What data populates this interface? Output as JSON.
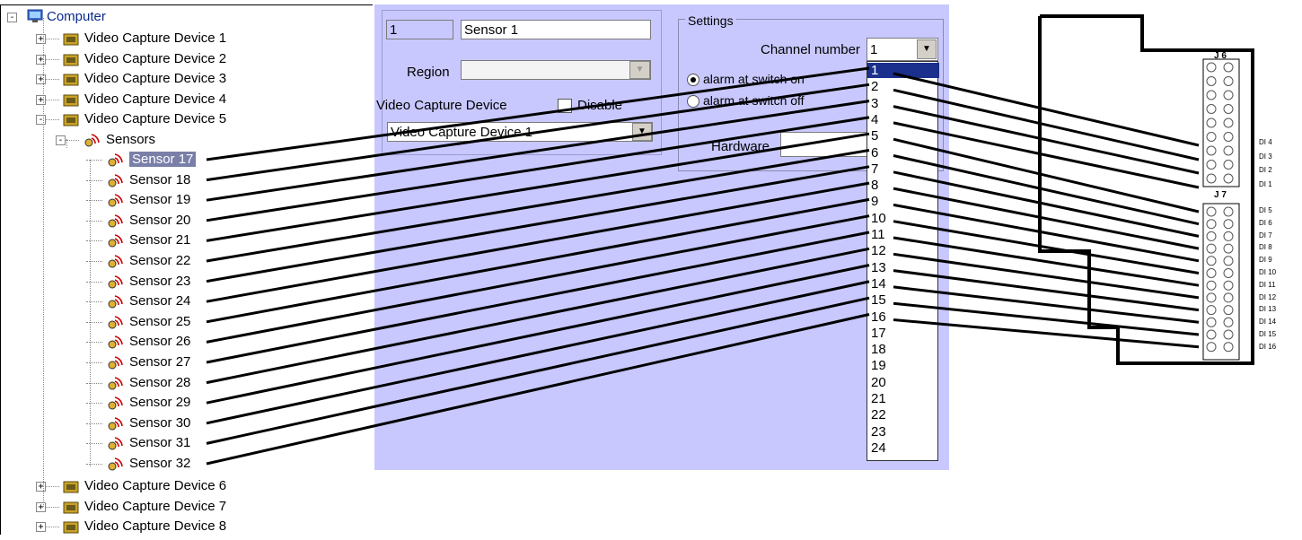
{
  "tree": {
    "root_label": "Computer",
    "devices_before": [
      "Video Capture Device 1",
      "Video Capture Device 2",
      "Video Capture Device 3",
      "Video Capture Device 4",
      "Video Capture Device 5"
    ],
    "sensors_node": "Sensors",
    "sensors": [
      "Sensor 17",
      "Sensor 18",
      "Sensor 19",
      "Sensor 20",
      "Sensor 21",
      "Sensor 22",
      "Sensor 23",
      "Sensor 24",
      "Sensor 25",
      "Sensor 26",
      "Sensor 27",
      "Sensor 28",
      "Sensor 29",
      "Sensor 30",
      "Sensor 31",
      "Sensor 32"
    ],
    "selected_sensor": "Sensor 17",
    "devices_after": [
      "Video Capture Device 6",
      "Video Capture Device 7",
      "Video Capture Device 8"
    ]
  },
  "form": {
    "id_value": "1",
    "name_value": "Sensor 1",
    "region_label": "Region",
    "region_value": "",
    "device_label": "Video Capture Device",
    "disable_label": "Disable",
    "device_value": "Video Capture Device 1"
  },
  "settings": {
    "title": "Settings",
    "channel_label": "Channel number",
    "channel_value": "1",
    "alarm_on_label": "alarm at switch on",
    "alarm_off_label": "alarm at switch off",
    "hardware_label": "Hardware",
    "channel_options": [
      "1",
      "2",
      "3",
      "4",
      "5",
      "6",
      "7",
      "8",
      "9",
      "10",
      "11",
      "12",
      "13",
      "14",
      "15",
      "16",
      "17",
      "18",
      "19",
      "20",
      "21",
      "22",
      "23",
      "24"
    ]
  },
  "pinout": {
    "j6_label": "J 6",
    "j7_label": "J 7",
    "j6_pins": [
      "DI 4",
      "DI 3",
      "DI 2",
      "DI 1"
    ],
    "j7_pins": [
      "DI 5",
      "DI 6",
      "DI 7",
      "DI 8",
      "DI 9",
      "DI 10",
      "DI 11",
      "DI 12",
      "DI 13",
      "DI 14",
      "DI 15",
      "DI 16"
    ]
  },
  "colors": {
    "dialog_bg": "#c8c8ff",
    "selected_bg": "#1b2f8c",
    "tree_selected_bg": "#7a7fa8"
  }
}
